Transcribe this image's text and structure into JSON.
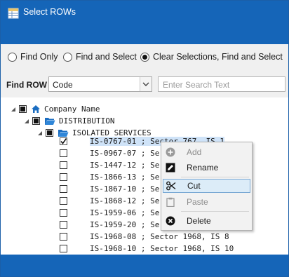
{
  "window": {
    "title": "Select ROWs"
  },
  "options": {
    "find_only": "Find Only",
    "find_and_select": "Find and Select",
    "clear_find_select": "Clear Selections, Find and Select",
    "selected": "clear_find_select"
  },
  "find": {
    "label": "Find ROW",
    "field_value": "Code",
    "search_placeholder": "Enter Search Text"
  },
  "tree": {
    "root": "Company Name",
    "level1": "DISTRIBUTION",
    "level2": "ISOLATED SERVICES",
    "rows": [
      {
        "text": "IS-0767-01 ; Sector 767, IS 1",
        "checked": true,
        "selected": true
      },
      {
        "text": "IS-0967-07 ; Se",
        "checked": false
      },
      {
        "text": "IS-1447-12 ; Se",
        "checked": false
      },
      {
        "text": "IS-1866-13 ; Se",
        "checked": false
      },
      {
        "text": "IS-1867-10 ; Se",
        "checked": false
      },
      {
        "text": "IS-1868-12 ; Se",
        "checked": false
      },
      {
        "text": "IS-1959-06 ; Se",
        "checked": false
      },
      {
        "text": "IS-1959-20 ; Se",
        "checked": false
      },
      {
        "text": "IS-1968-08 ; Sector 1968, IS 8",
        "checked": false
      },
      {
        "text": "IS-1968-10 ; Sector 1968, IS 10",
        "checked": false
      }
    ]
  },
  "context_menu": {
    "add": "Add",
    "rename": "Rename",
    "cut": "Cut",
    "paste": "Paste",
    "delete": "Delete"
  },
  "colors": {
    "accent": "#1565b8",
    "selection": "#cfe3f8",
    "menu_hover": "#dcecf8"
  }
}
